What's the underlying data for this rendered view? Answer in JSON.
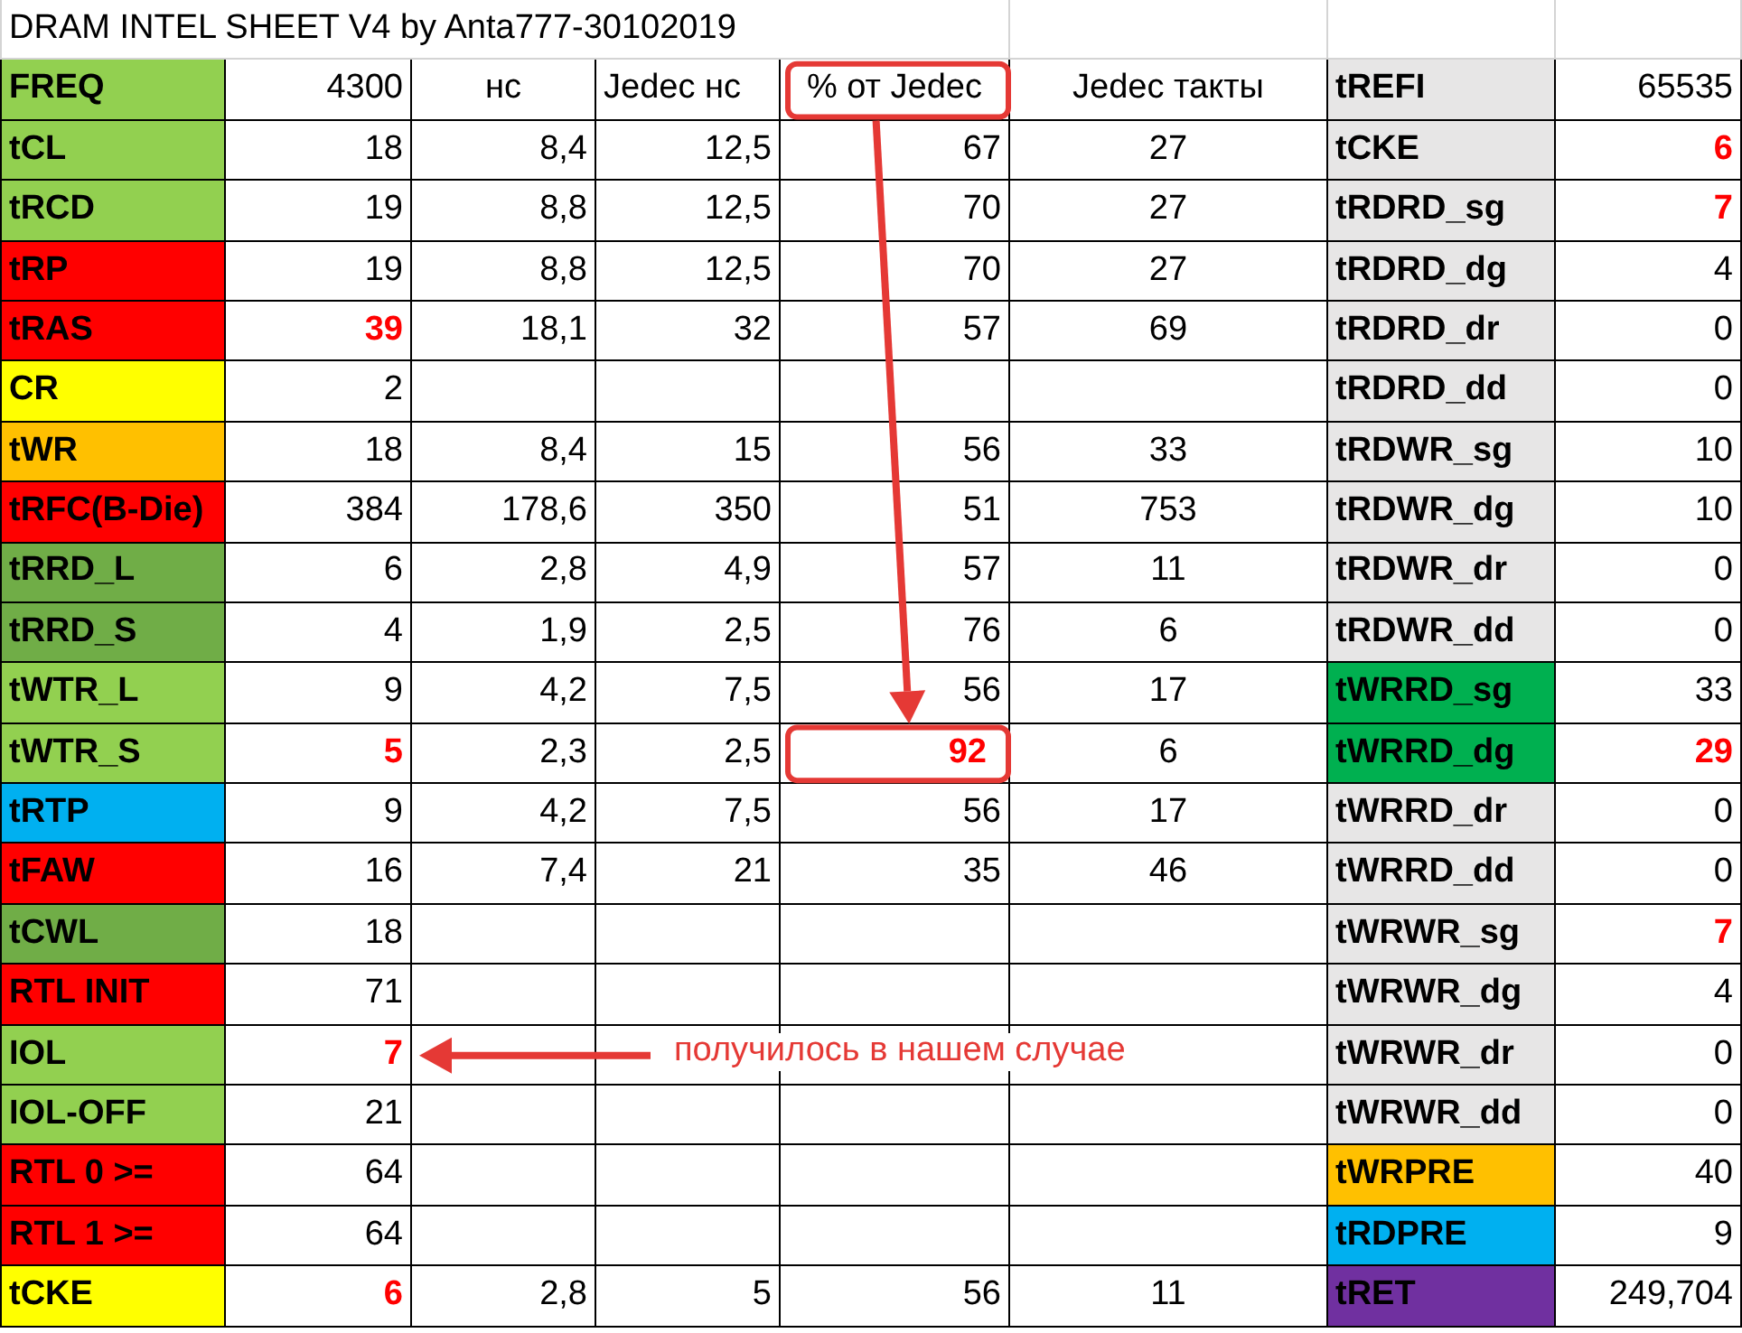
{
  "title": "DRAM INTEL SHEET V4 by Anta777-30102019",
  "header": {
    "label": "FREQ",
    "color": "#92d050",
    "value": "4300",
    "columns": [
      {
        "text": "нс",
        "boxed": false
      },
      {
        "text": "Jedec нс",
        "boxed": false
      },
      {
        "text": "% от Jedec",
        "boxed": true
      },
      {
        "text": "Jedec такты",
        "boxed": false
      }
    ],
    "right": {
      "label": "tREFI",
      "color": "#e7e6e6",
      "value": "65535",
      "alert": false
    }
  },
  "rows": [
    {
      "label": "tCL",
      "color": "#92d050",
      "cells": [
        {
          "text": "18",
          "alert": false,
          "boxed": false
        },
        {
          "text": "8,4",
          "alert": false,
          "boxed": false
        },
        {
          "text": "12,5",
          "alert": false,
          "boxed": false
        },
        {
          "text": "67",
          "alert": false,
          "boxed": false
        },
        {
          "text": "27",
          "alert": false,
          "boxed": false
        }
      ],
      "right": {
        "label": "tCKE",
        "color": "#e7e6e6",
        "value": "6",
        "alert": true
      }
    },
    {
      "label": "tRCD",
      "color": "#92d050",
      "cells": [
        {
          "text": "19",
          "alert": false,
          "boxed": false
        },
        {
          "text": "8,8",
          "alert": false,
          "boxed": false
        },
        {
          "text": "12,5",
          "alert": false,
          "boxed": false
        },
        {
          "text": "70",
          "alert": false,
          "boxed": false
        },
        {
          "text": "27",
          "alert": false,
          "boxed": false
        }
      ],
      "right": {
        "label": "tRDRD_sg",
        "color": "#e7e6e6",
        "value": "7",
        "alert": true
      }
    },
    {
      "label": "tRP",
      "color": "#ff0000",
      "cells": [
        {
          "text": "19",
          "alert": false,
          "boxed": false
        },
        {
          "text": "8,8",
          "alert": false,
          "boxed": false
        },
        {
          "text": "12,5",
          "alert": false,
          "boxed": false
        },
        {
          "text": "70",
          "alert": false,
          "boxed": false
        },
        {
          "text": "27",
          "alert": false,
          "boxed": false
        }
      ],
      "right": {
        "label": "tRDRD_dg",
        "color": "#e7e6e6",
        "value": "4",
        "alert": false
      }
    },
    {
      "label": "tRAS",
      "color": "#ff0000",
      "cells": [
        {
          "text": "39",
          "alert": true,
          "boxed": false
        },
        {
          "text": "18,1",
          "alert": false,
          "boxed": false
        },
        {
          "text": "32",
          "alert": false,
          "boxed": false
        },
        {
          "text": "57",
          "alert": false,
          "boxed": false
        },
        {
          "text": "69",
          "alert": false,
          "boxed": false
        }
      ],
      "right": {
        "label": "tRDRD_dr",
        "color": "#e7e6e6",
        "value": "0",
        "alert": false
      }
    },
    {
      "label": "CR",
      "color": "#ffff00",
      "cells": [
        {
          "text": "2",
          "alert": false,
          "boxed": false
        }
      ],
      "right": {
        "label": "tRDRD_dd",
        "color": "#e7e6e6",
        "value": "0",
        "alert": false
      }
    },
    {
      "label": "tWR",
      "color": "#ffc000",
      "cells": [
        {
          "text": "18",
          "alert": false,
          "boxed": false
        },
        {
          "text": "8,4",
          "alert": false,
          "boxed": false
        },
        {
          "text": "15",
          "alert": false,
          "boxed": false
        },
        {
          "text": "56",
          "alert": false,
          "boxed": false
        },
        {
          "text": "33",
          "alert": false,
          "boxed": false
        }
      ],
      "right": {
        "label": "tRDWR_sg",
        "color": "#e7e6e6",
        "value": "10",
        "alert": false
      }
    },
    {
      "label": "tRFC(B-Die)",
      "color": "#ff0000",
      "cells": [
        {
          "text": "384",
          "alert": false,
          "boxed": false
        },
        {
          "text": "178,6",
          "alert": false,
          "boxed": false
        },
        {
          "text": "350",
          "alert": false,
          "boxed": false
        },
        {
          "text": "51",
          "alert": false,
          "boxed": false
        },
        {
          "text": "753",
          "alert": false,
          "boxed": false
        }
      ],
      "right": {
        "label": "tRDWR_dg",
        "color": "#e7e6e6",
        "value": "10",
        "alert": false
      }
    },
    {
      "label": "tRRD_L",
      "color": "#70ad47",
      "cells": [
        {
          "text": "6",
          "alert": false,
          "boxed": false
        },
        {
          "text": "2,8",
          "alert": false,
          "boxed": false
        },
        {
          "text": "4,9",
          "alert": false,
          "boxed": false
        },
        {
          "text": "57",
          "alert": false,
          "boxed": false
        },
        {
          "text": "11",
          "alert": false,
          "boxed": false
        }
      ],
      "right": {
        "label": "tRDWR_dr",
        "color": "#e7e6e6",
        "value": "0",
        "alert": false
      }
    },
    {
      "label": "tRRD_S",
      "color": "#70ad47",
      "cells": [
        {
          "text": "4",
          "alert": false,
          "boxed": false
        },
        {
          "text": "1,9",
          "alert": false,
          "boxed": false
        },
        {
          "text": "2,5",
          "alert": false,
          "boxed": false
        },
        {
          "text": "76",
          "alert": false,
          "boxed": false
        },
        {
          "text": "6",
          "alert": false,
          "boxed": false
        }
      ],
      "right": {
        "label": "tRDWR_dd",
        "color": "#e7e6e6",
        "value": "0",
        "alert": false
      }
    },
    {
      "label": "tWTR_L",
      "color": "#92d050",
      "cells": [
        {
          "text": "9",
          "alert": false,
          "boxed": false
        },
        {
          "text": "4,2",
          "alert": false,
          "boxed": false
        },
        {
          "text": "7,5",
          "alert": false,
          "boxed": false
        },
        {
          "text": "56",
          "alert": false,
          "boxed": false
        },
        {
          "text": "17",
          "alert": false,
          "boxed": false
        }
      ],
      "right": {
        "label": "tWRRD_sg",
        "color": "#00b050",
        "value": "33",
        "alert": false
      }
    },
    {
      "label": "tWTR_S",
      "color": "#92d050",
      "cells": [
        {
          "text": "5",
          "alert": true,
          "boxed": false
        },
        {
          "text": "2,3",
          "alert": false,
          "boxed": false
        },
        {
          "text": "2,5",
          "alert": false,
          "boxed": false
        },
        {
          "text": "92",
          "alert": true,
          "boxed": true
        },
        {
          "text": "6",
          "alert": false,
          "boxed": false
        }
      ],
      "right": {
        "label": "tWRRD_dg",
        "color": "#00b050",
        "value": "29",
        "alert": true
      }
    },
    {
      "label": "tRTP",
      "color": "#00b0f0",
      "cells": [
        {
          "text": "9",
          "alert": false,
          "boxed": false
        },
        {
          "text": "4,2",
          "alert": false,
          "boxed": false
        },
        {
          "text": "7,5",
          "alert": false,
          "boxed": false
        },
        {
          "text": "56",
          "alert": false,
          "boxed": false
        },
        {
          "text": "17",
          "alert": false,
          "boxed": false
        }
      ],
      "right": {
        "label": "tWRRD_dr",
        "color": "#e7e6e6",
        "value": "0",
        "alert": false
      }
    },
    {
      "label": "tFAW",
      "color": "#ff0000",
      "cells": [
        {
          "text": "16",
          "alert": false,
          "boxed": false
        },
        {
          "text": "7,4",
          "alert": false,
          "boxed": false
        },
        {
          "text": "21",
          "alert": false,
          "boxed": false
        },
        {
          "text": "35",
          "alert": false,
          "boxed": false
        },
        {
          "text": "46",
          "alert": false,
          "boxed": false
        }
      ],
      "right": {
        "label": "tWRRD_dd",
        "color": "#e7e6e6",
        "value": "0",
        "alert": false
      }
    },
    {
      "label": "tCWL",
      "color": "#70ad47",
      "cells": [
        {
          "text": "18",
          "alert": false,
          "boxed": false
        }
      ],
      "right": {
        "label": "tWRWR_sg",
        "color": "#e7e6e6",
        "value": "7",
        "alert": true
      }
    },
    {
      "label": "RTL INIT",
      "color": "#ff0000",
      "cells": [
        {
          "text": "71",
          "alert": false,
          "boxed": false
        }
      ],
      "right": {
        "label": "tWRWR_dg",
        "color": "#e7e6e6",
        "value": "4",
        "alert": false
      }
    },
    {
      "label": "IOL",
      "color": "#92d050",
      "cells": [
        {
          "text": "7",
          "alert": true,
          "boxed": false
        }
      ],
      "note": "получилось в нашем случае",
      "right": {
        "label": "tWRWR_dr",
        "color": "#e7e6e6",
        "value": "0",
        "alert": false
      }
    },
    {
      "label": "IOL-OFF",
      "color": "#92d050",
      "cells": [
        {
          "text": "21",
          "alert": false,
          "boxed": false
        }
      ],
      "right": {
        "label": "tWRWR_dd",
        "color": "#e7e6e6",
        "value": "0",
        "alert": false
      }
    },
    {
      "label": "RTL 0 >=",
      "color": "#ff0000",
      "cells": [
        {
          "text": "64",
          "alert": false,
          "boxed": false
        }
      ],
      "right": {
        "label": "tWRPRE",
        "color": "#ffc000",
        "value": "40",
        "alert": false
      }
    },
    {
      "label": "RTL 1 >=",
      "color": "#ff0000",
      "cells": [
        {
          "text": "64",
          "alert": false,
          "boxed": false
        }
      ],
      "right": {
        "label": "tRDPRE",
        "color": "#00b0f0",
        "value": "9",
        "alert": false
      }
    },
    {
      "label": "tCKE",
      "color": "#ffff00",
      "cells": [
        {
          "text": "6",
          "alert": true,
          "boxed": false
        },
        {
          "text": "2,8",
          "alert": false,
          "boxed": false
        },
        {
          "text": "5",
          "alert": false,
          "boxed": false
        },
        {
          "text": "56",
          "alert": false,
          "boxed": false
        },
        {
          "text": "11",
          "alert": false,
          "boxed": false
        }
      ],
      "right": {
        "label": "tRET",
        "color": "#7030a0",
        "value": "249,704",
        "alert": false
      }
    }
  ]
}
